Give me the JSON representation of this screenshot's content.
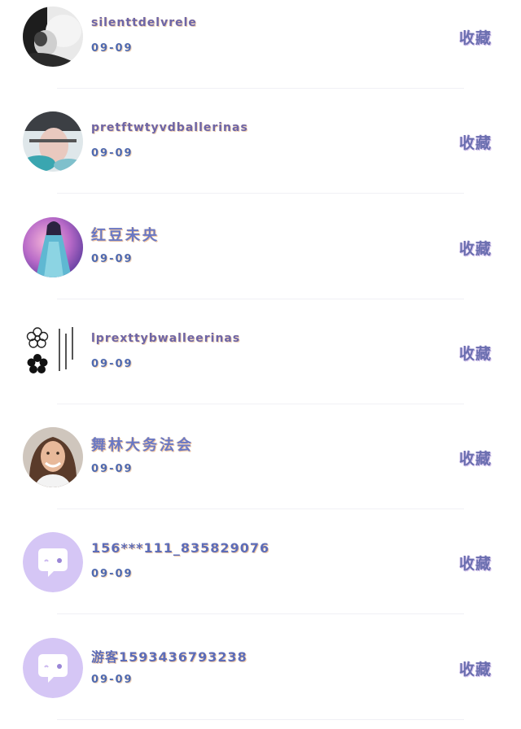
{
  "rows": [
    {
      "name": "silenttdelvrele",
      "date": "09-09",
      "action": "收藏",
      "avatar": "bw-portrait"
    },
    {
      "name": "pretftwtyvdballerinas",
      "date": "09-09",
      "action": "收藏",
      "avatar": "hands-photo"
    },
    {
      "name": "红豆未央",
      "date": "09-09",
      "action": "收藏",
      "avatar": "fantasy-girl"
    },
    {
      "name": "lprexttybwalleerinas",
      "date": "09-09",
      "action": "收藏",
      "avatar": "flower-text"
    },
    {
      "name": "舞林大务法会",
      "date": "09-09",
      "action": "收藏",
      "avatar": "smiling-woman"
    },
    {
      "name": "156***111_835829076",
      "date": "09-09",
      "action": "收藏",
      "avatar": "default-chat"
    },
    {
      "name": "游客1593436793238",
      "date": "09-09",
      "action": "收藏",
      "avatar": "default-chat"
    }
  ],
  "colors": {
    "name_text": "#6d66a8",
    "date_text": "#4f6ab0",
    "action_text": "#6b6fb0",
    "default_avatar_bg": "#d5c6f5"
  }
}
